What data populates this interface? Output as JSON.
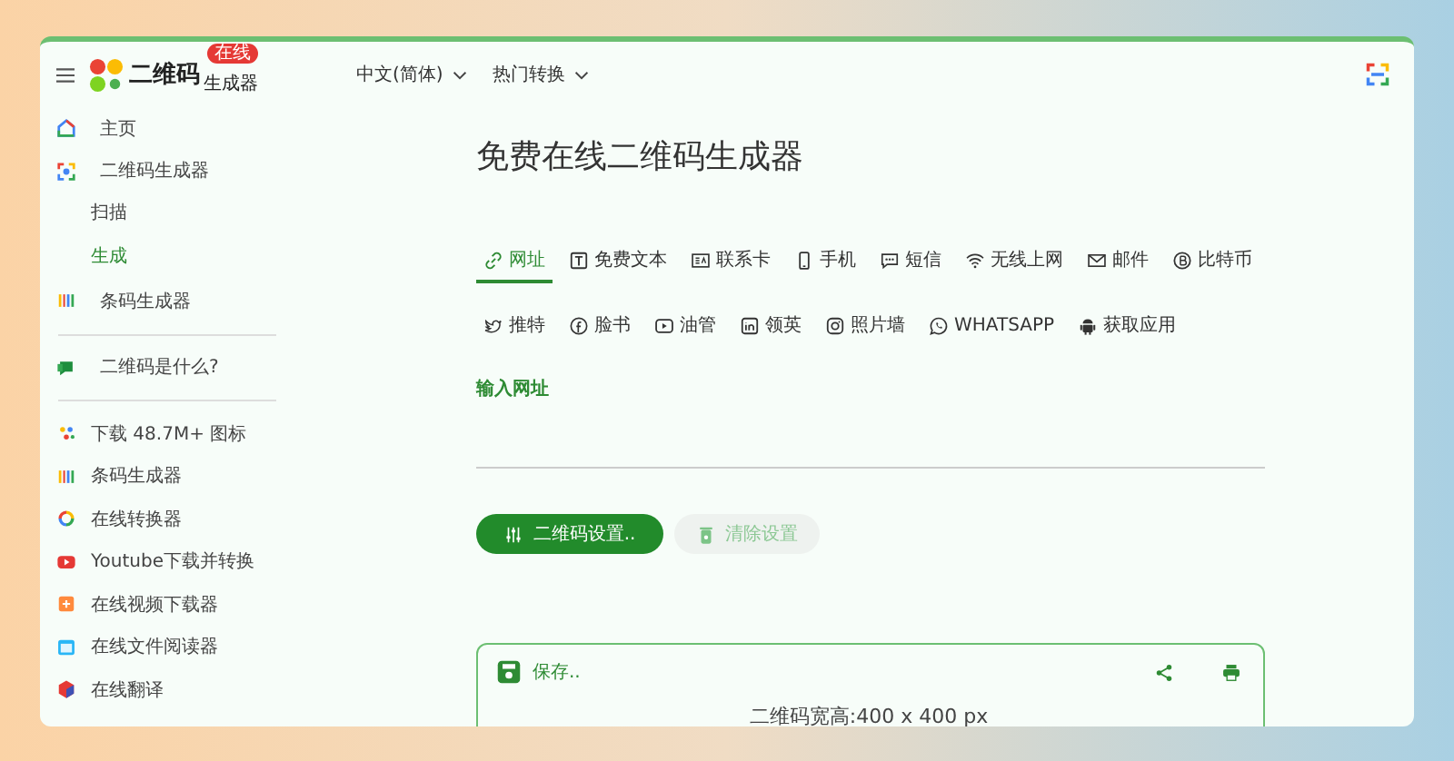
{
  "header": {
    "logo_text": "二维码",
    "logo_sub": "生成器",
    "badge": "在线",
    "menus": [
      {
        "label": "中文(简体)"
      },
      {
        "label": "热门转换"
      }
    ]
  },
  "sidebar": {
    "groups": [
      {
        "items": [
          {
            "label": "主页",
            "selected": false
          },
          {
            "label": "二维码生成器",
            "selected": false,
            "children": [
              {
                "label": "扫描",
                "selected": false
              },
              {
                "label": "生成",
                "selected": true
              }
            ]
          },
          {
            "label": "条码生成器",
            "selected": false
          }
        ]
      },
      {
        "items": [
          {
            "label": "二维码是什么?",
            "selected": false
          }
        ]
      },
      {
        "items": [
          {
            "label": "下载 48.7M+ 图标",
            "selected": false
          },
          {
            "label": "条码生成器",
            "selected": false
          },
          {
            "label": "在线转换器",
            "selected": false
          },
          {
            "label": "Youtube下载并转换",
            "selected": false
          },
          {
            "label": "在线视频下载器",
            "selected": false
          },
          {
            "label": "在线文件阅读器",
            "selected": false
          },
          {
            "label": "在线翻译",
            "selected": false
          }
        ]
      }
    ]
  },
  "main": {
    "title": "免费在线二维码生成器",
    "tab_rows": [
      [
        {
          "label": "网址",
          "selected": true
        },
        {
          "label": "免费文本",
          "selected": false
        },
        {
          "label": "联系卡",
          "selected": false
        },
        {
          "label": "手机",
          "selected": false
        },
        {
          "label": "短信",
          "selected": false
        },
        {
          "label": "无线上网",
          "selected": false
        },
        {
          "label": "邮件",
          "selected": false
        },
        {
          "label": "比特币",
          "selected": false
        }
      ],
      [
        {
          "label": "推特",
          "selected": false
        },
        {
          "label": "脸书",
          "selected": false
        },
        {
          "label": "油管",
          "selected": false
        },
        {
          "label": "领英",
          "selected": false
        },
        {
          "label": "照片墙",
          "selected": false
        },
        {
          "label": "WHATSAPP",
          "selected": false
        },
        {
          "label": "获取应用",
          "selected": false
        }
      ]
    ],
    "field": {
      "label": "输入网址"
    },
    "buttons": [
      {
        "label": "二维码设置..",
        "disabled": false
      },
      {
        "label": "清除设置",
        "disabled": true
      }
    ],
    "result": {
      "save": "保存..",
      "size": "二维码宽高:400 x 400 px"
    }
  }
}
